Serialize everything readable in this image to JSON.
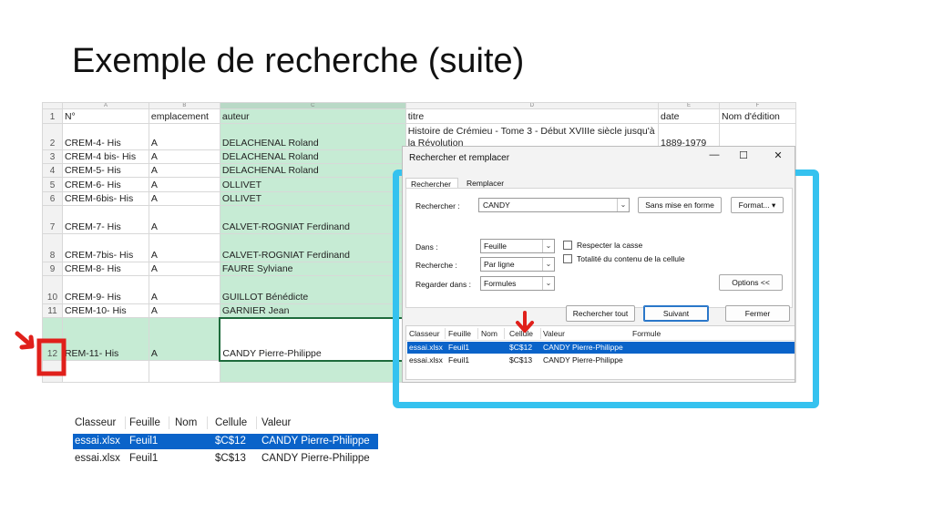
{
  "slide": {
    "title": "Exemple de recherche (suite)"
  },
  "sheet": {
    "col_letters": [
      "A",
      "B",
      "C",
      "D",
      "E",
      "F"
    ],
    "rows": [
      {
        "n": "1",
        "a": "N°",
        "b": "emplacement",
        "c": "auteur",
        "d": "titre",
        "e": "date",
        "f": "Nom d'édition"
      },
      {
        "n": "2",
        "a": "CREM-4- His",
        "b": "A",
        "c": "DELACHENAL Roland",
        "d": "Histoire de  Crémieu - Tome 3 - Début XVIIIe siècle jusqu'à la Révolution",
        "e": "1889-1979",
        "f": ""
      },
      {
        "n": "3",
        "a": "CREM-4 bis- His",
        "b": "A",
        "c": "DELACHENAL Roland",
        "d": "",
        "e": "",
        "f": ""
      },
      {
        "n": "4",
        "a": "CREM-5- His",
        "b": "A",
        "c": "DELACHENAL Roland",
        "d": "",
        "e": "",
        "f": ""
      },
      {
        "n": "5",
        "a": "CREM-6- His",
        "b": "A",
        "c": "OLLIVET",
        "d": "",
        "e": "",
        "f": ""
      },
      {
        "n": "6",
        "a": "CREM-6bis- His",
        "b": "A",
        "c": "OLLIVET",
        "d": "",
        "e": "",
        "f": ""
      },
      {
        "n": "7",
        "a": "CREM-7- His",
        "b": "A",
        "c": "CALVET-ROGNIAT Ferdinand",
        "d": "",
        "e": "",
        "f": ""
      },
      {
        "n": "8",
        "a": "CREM-7bis- His",
        "b": "A",
        "c": "CALVET-ROGNIAT Ferdinand",
        "d": "",
        "e": "",
        "f": ""
      },
      {
        "n": "9",
        "a": "CREM-8- His",
        "b": "A",
        "c": "FAURE Sylviane",
        "d": "",
        "e": "",
        "f": ""
      },
      {
        "n": "10",
        "a": "CREM-9- His",
        "b": "A",
        "c": "GUILLOT Bénédicte",
        "d": "",
        "e": "",
        "f": ""
      },
      {
        "n": "11",
        "a": "CREM-10- His",
        "b": "A",
        "c": "GARNIER Jean",
        "d": "",
        "e": "",
        "f": ""
      },
      {
        "n": "12",
        "a": "REM-11- His",
        "b": "A",
        "c": "CANDY Pierre-Philippe",
        "d": "",
        "e": "",
        "f": ""
      }
    ]
  },
  "dialog": {
    "title": "Rechercher et remplacer",
    "controls": {
      "minimize": "—",
      "maximize": "☐",
      "close": "✕"
    },
    "tabs": [
      "Rechercher",
      "Remplacer"
    ],
    "search_label": "Rechercher :",
    "search_value": "CANDY",
    "no_format_button": "Sans mise en forme",
    "format_button": "Format...",
    "within_label": "Dans :",
    "within_value": "Feuille",
    "search_by_label": "Recherche :",
    "search_by_value": "Par ligne",
    "look_in_label": "Regarder dans :",
    "look_in_value": "Formules",
    "match_case": "Respecter la casse",
    "entire_cell": "Totalité du contenu de la cellule",
    "options_button": "Options <<",
    "find_all_button": "Rechercher tout",
    "find_next_button": "Suivant",
    "close_button": "Fermer",
    "results_headers": [
      "Classeur",
      "Feuille",
      "Nom",
      "Cellule",
      "Valeur",
      "Formule"
    ],
    "results": [
      {
        "classeur": "essai.xlsx",
        "feuille": "Feuil1",
        "nom": "",
        "cellule": "$C$12",
        "valeur": "CANDY Pierre-Philippe"
      },
      {
        "classeur": "essai.xlsx",
        "feuille": "Feuil1",
        "nom": "",
        "cellule": "$C$13",
        "valeur": "CANDY Pierre-Philippe"
      }
    ]
  },
  "zoom": {
    "headers": [
      "Classeur",
      "Feuille",
      "Nom",
      "Cellule",
      "Valeur"
    ],
    "rows": [
      {
        "classeur": "essai.xlsx",
        "feuille": "Feuil1",
        "nom": "",
        "cellule": "$C$12",
        "valeur": "CANDY Pierre-Philippe"
      },
      {
        "classeur": "essai.xlsx",
        "feuille": "Feuil1",
        "nom": "",
        "cellule": "$C$13",
        "valeur": "CANDY Pierre-Philippe"
      }
    ]
  },
  "colors": {
    "accent": "#35c2ef",
    "selection": "#0a63c9",
    "green_column": "#c6ebd4",
    "marker": "#e0201b"
  }
}
